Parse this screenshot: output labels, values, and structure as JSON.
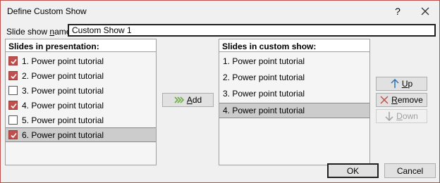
{
  "dialog": {
    "title": "Define Custom Show",
    "help_label": "?",
    "name_label_pre": "Slide show ",
    "name_label_accel": "n",
    "name_label_post": "ame:",
    "name_value": "Custom Show 1"
  },
  "presentation": {
    "header": "Slides in presentation:",
    "items": [
      {
        "label": "1. Power point tutorial",
        "checked": true
      },
      {
        "label": "2.  Power point tutorial",
        "checked": true
      },
      {
        "label": "3.  Power point tutorial",
        "checked": false
      },
      {
        "label": "4.  Power point tutorial",
        "checked": true
      },
      {
        "label": "5.  Power point tutorial",
        "checked": false
      },
      {
        "label": "6. Power point tutorial",
        "checked": true
      }
    ]
  },
  "custom_show": {
    "header": "Slides in custom show:",
    "items": [
      {
        "label": "1. Power point tutorial"
      },
      {
        "label": "2.  Power point tutorial"
      },
      {
        "label": "3.  Power point tutorial"
      },
      {
        "label": "4. Power point tutorial"
      }
    ]
  },
  "buttons": {
    "add_accel": "A",
    "add_rest": "dd",
    "up_accel": "U",
    "up_rest": "p",
    "remove_accel": "R",
    "remove_rest": "emove",
    "down_accel": "D",
    "down_rest": "own",
    "ok": "OK",
    "cancel": "Cancel"
  },
  "colors": {
    "check_accent": "#c0504d",
    "up_arrow": "#2e75b6",
    "remove_x": "#c0504d",
    "add_arrows": "#70ad47"
  },
  "icons": {
    "help": "question-icon",
    "close": "close-icon",
    "add": "double-chevron-right-icon",
    "up": "arrow-up-icon",
    "remove": "x-icon",
    "down": "arrow-down-icon"
  }
}
